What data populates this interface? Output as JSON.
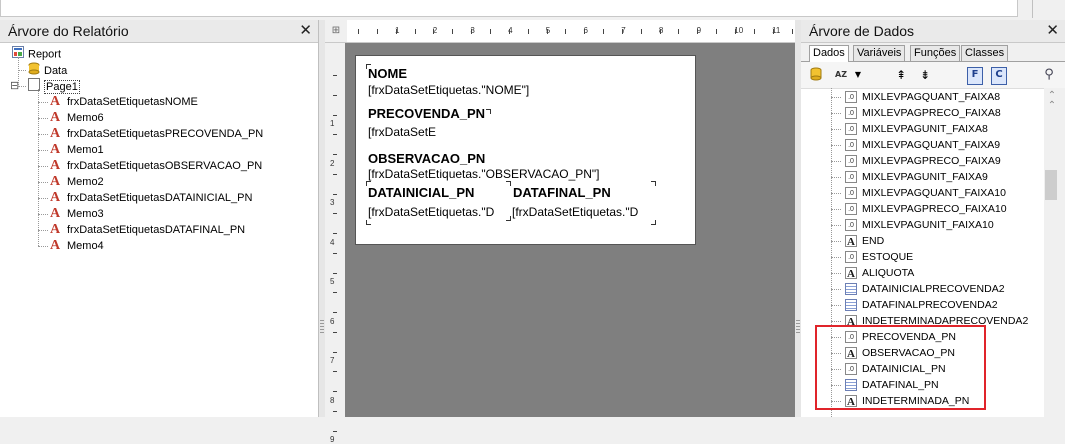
{
  "left_panel": {
    "title": "Árvore do Relatório",
    "close_glyph": "✕",
    "tree": [
      {
        "label": "Report",
        "icon": "report-icon",
        "level": 0
      },
      {
        "label": "Data",
        "icon": "database-icon",
        "level": 1
      },
      {
        "label": "Page1",
        "icon": "page-icon",
        "level": 1,
        "expander": "⊟"
      },
      {
        "label": "frxDataSetEtiquetasNOME",
        "icon": "text-memo-icon",
        "level": 2
      },
      {
        "label": "Memo6",
        "icon": "text-memo-icon",
        "level": 2
      },
      {
        "label": "frxDataSetEtiquetasPRECOVENDA_PN",
        "icon": "text-memo-icon",
        "level": 2
      },
      {
        "label": "Memo1",
        "icon": "text-memo-icon",
        "level": 2
      },
      {
        "label": "frxDataSetEtiquetasOBSERVACAO_PN",
        "icon": "text-memo-icon",
        "level": 2
      },
      {
        "label": "Memo2",
        "icon": "text-memo-icon",
        "level": 2
      },
      {
        "label": "frxDataSetEtiquetasDATAINICIAL_PN",
        "icon": "text-memo-icon",
        "level": 2
      },
      {
        "label": "Memo3",
        "icon": "text-memo-icon",
        "level": 2
      },
      {
        "label": "frxDataSetEtiquetasDATAFINAL_PN",
        "icon": "text-memo-icon",
        "level": 2
      },
      {
        "label": "Memo4",
        "icon": "text-memo-icon",
        "level": 2
      }
    ]
  },
  "designer": {
    "ruler_h": [
      "1",
      "2",
      "3",
      "4",
      "5",
      "6",
      "7",
      "8",
      "9",
      "10",
      "11"
    ],
    "ruler_v": [
      "1",
      "2",
      "3",
      "4",
      "5",
      "6",
      "7",
      "8",
      "9"
    ],
    "page": {
      "h_nome": "NOME",
      "f_nome": "[frxDataSetEtiquetas.\"NOME\"]",
      "h_preco": "PRECOVENDA_PN",
      "f_preco": "[frxDataSetE",
      "h_obs": "OBSERVACAO_PN",
      "f_obs": "[frxDataSetEtiquetas.\"OBSERVACAO_PN\"]",
      "h_dataini": "DATAINICIAL_PN",
      "h_datafin": "DATAFINAL_PN",
      "f_dataini": "[frxDataSetEtiquetas.\"D",
      "f_datafin": "[frxDataSetEtiquetas.\"D"
    }
  },
  "right_panel": {
    "title": "Árvore de Dados",
    "close_glyph": "✕",
    "tabs": [
      "Dados",
      "Variáveis",
      "Funções",
      "Classes"
    ],
    "active_tab": "Dados",
    "toolbar": {
      "sort_label": "AZ",
      "btn_f": "F",
      "btn_c": "C"
    },
    "items": [
      {
        "label": "MIXLEVPAGQUANT_FAIXA8",
        "type": "number"
      },
      {
        "label": "MIXLEVPAGPRECO_FAIXA8",
        "type": "number"
      },
      {
        "label": "MIXLEVPAGUNIT_FAIXA8",
        "type": "number"
      },
      {
        "label": "MIXLEVPAGQUANT_FAIXA9",
        "type": "number"
      },
      {
        "label": "MIXLEVPAGPRECO_FAIXA9",
        "type": "number"
      },
      {
        "label": "MIXLEVPAGUNIT_FAIXA9",
        "type": "number"
      },
      {
        "label": "MIXLEVPAGQUANT_FAIXA10",
        "type": "number"
      },
      {
        "label": "MIXLEVPAGPRECO_FAIXA10",
        "type": "number"
      },
      {
        "label": "MIXLEVPAGUNIT_FAIXA10",
        "type": "number"
      },
      {
        "label": "END",
        "type": "text"
      },
      {
        "label": "ESTOQUE",
        "type": "number"
      },
      {
        "label": "ALIQUOTA",
        "type": "text"
      },
      {
        "label": "DATAINICIALPRECOVENDA2",
        "type": "date"
      },
      {
        "label": "DATAFINALPRECOVENDA2",
        "type": "date"
      },
      {
        "label": "INDETERMINADAPRECOVENDA2",
        "type": "text"
      },
      {
        "label": "PRECOVENDA_PN",
        "type": "number"
      },
      {
        "label": "OBSERVACAO_PN",
        "type": "text"
      },
      {
        "label": "DATAINICIAL_PN",
        "type": "number"
      },
      {
        "label": "DATAFINAL_PN",
        "type": "date"
      },
      {
        "label": "INDETERMINADA_PN",
        "type": "text"
      }
    ],
    "highlight_color": "#e0242a"
  }
}
